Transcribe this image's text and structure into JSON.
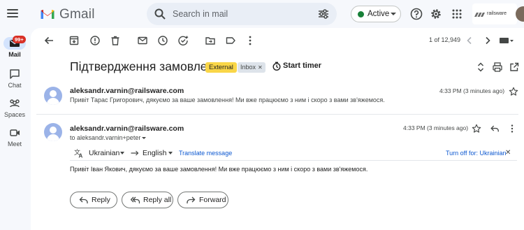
{
  "app": {
    "name": "Gmail"
  },
  "search": {
    "placeholder": "Search in mail"
  },
  "status": {
    "label": "Active",
    "color": "#188038"
  },
  "account": {
    "org_logo_text": "railsware"
  },
  "rail": {
    "items": [
      {
        "label": "Mail",
        "icon": "mail-icon",
        "badge": "99+"
      },
      {
        "label": "Chat",
        "icon": "chat-icon"
      },
      {
        "label": "Spaces",
        "icon": "spaces-icon"
      },
      {
        "label": "Meet",
        "icon": "meet-icon"
      }
    ]
  },
  "toolbar": {
    "icons": [
      "back-icon",
      "archive-icon",
      "report-spam-icon",
      "delete-icon",
      "mark-unread-icon",
      "snooze-icon",
      "add-task-icon",
      "move-to-icon",
      "label-icon",
      "more-icon"
    ],
    "pager": "1 of 12,949"
  },
  "thread": {
    "subject": "Підтвердження замовлення",
    "labels": {
      "external": "External",
      "inbox": "Inbox"
    },
    "start_timer": "Start timer"
  },
  "messages": [
    {
      "sender": "aleksandr.varnin@railsware.com",
      "snippet": "Привіт Тарас Григорович, дякуємо за ваше замовлення! Ми вже працюємо з ним і скоро з вами зв'яжемося.",
      "time": "4:33 PM (3 minutes ago)"
    },
    {
      "sender": "aleksandr.varnin@railsware.com",
      "to": "to aleksandr.varnin+peter",
      "time": "4:33 PM (3 minutes ago)",
      "body": "Привіт Іван Якович, дякуємо за ваше замовлення! Ми вже працюємо з ним і скоро з вами зв'яжемося."
    }
  ],
  "translate": {
    "from": "Ukrainian",
    "to": "English",
    "action": "Translate message",
    "turn_off": "Turn off for: Ukrainian"
  },
  "actions": {
    "reply": "Reply",
    "reply_all": "Reply all",
    "forward": "Forward"
  },
  "colors": {
    "accent": "#0b57d0",
    "external_label": "#f9d648",
    "badge": "#d93025"
  }
}
